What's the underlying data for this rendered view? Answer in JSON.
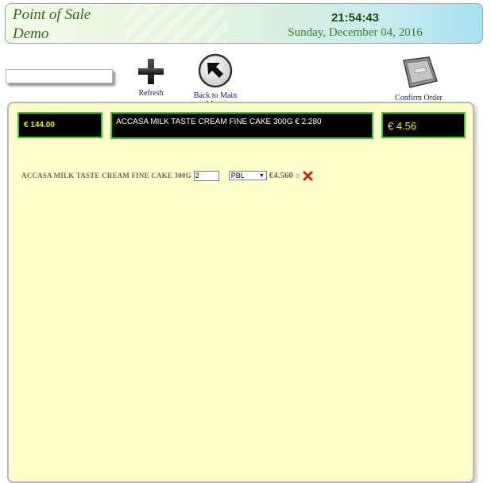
{
  "header": {
    "app_title_line1": "Point of Sale",
    "app_title_line2": "Demo",
    "time": "21:54:43",
    "date": "Sunday, December 04, 2016"
  },
  "toolbar": {
    "search_value": "",
    "refresh_label": "Refresh",
    "back_label": "Back to Main Menu",
    "confirm_label": "Confirm Order"
  },
  "summary": {
    "total": "€ 144.00",
    "last_item": "ACCASA MILK TASTE CREAM FINE CAKE 300G € 2.280",
    "last_price": "€ 4.56"
  },
  "order": {
    "items": [
      {
        "name": "ACCASA MILK TASTE CREAM FINE CAKE 300G",
        "quantity": "2",
        "unit": "PBL",
        "price": "€4.560"
      }
    ]
  },
  "colors": {
    "panel_bg": "#ffffcc",
    "box_border": "#33cc33",
    "delete_icon": "#cc2222"
  }
}
